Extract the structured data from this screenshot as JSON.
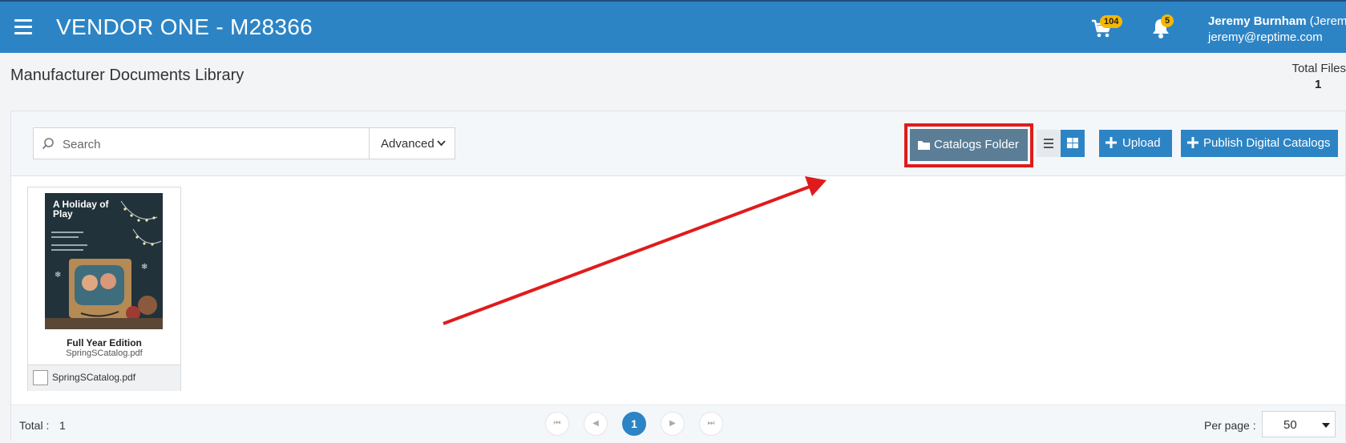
{
  "header": {
    "app_title": "VENDOR ONE - M28366",
    "cart_count": "104",
    "notification_count": "5",
    "user_name": "Jeremy Burnham",
    "user_suffix": " (Jeremy",
    "user_email": "jeremy@reptime.com"
  },
  "page": {
    "title": "Manufacturer Documents Library",
    "total_files_label": "Total Files",
    "total_files_value": "1"
  },
  "toolbar": {
    "search_placeholder": "Search",
    "advanced_label": "Advanced",
    "catalogs_folder_label": "Catalogs Folder",
    "upload_label": "Upload",
    "publish_label": "Publish Digital Catalogs"
  },
  "documents": [
    {
      "thumbnail_title": "A Holiday of Play",
      "title": "Full Year Edition",
      "file_name": "SpringSCatalog.pdf",
      "footer_name": "SpringSCatalog.pdf"
    }
  ],
  "pagination": {
    "total_label": "Total :",
    "total_value": "1",
    "current_page": "1",
    "per_page_label": "Per page :",
    "per_page_value": "50"
  },
  "colors": {
    "header_bg": "#2d84c5",
    "badge": "#f5b800",
    "catalogs_button": "#5b7d96",
    "highlight": "#e01b1b",
    "arrow": "#e01b1b"
  }
}
